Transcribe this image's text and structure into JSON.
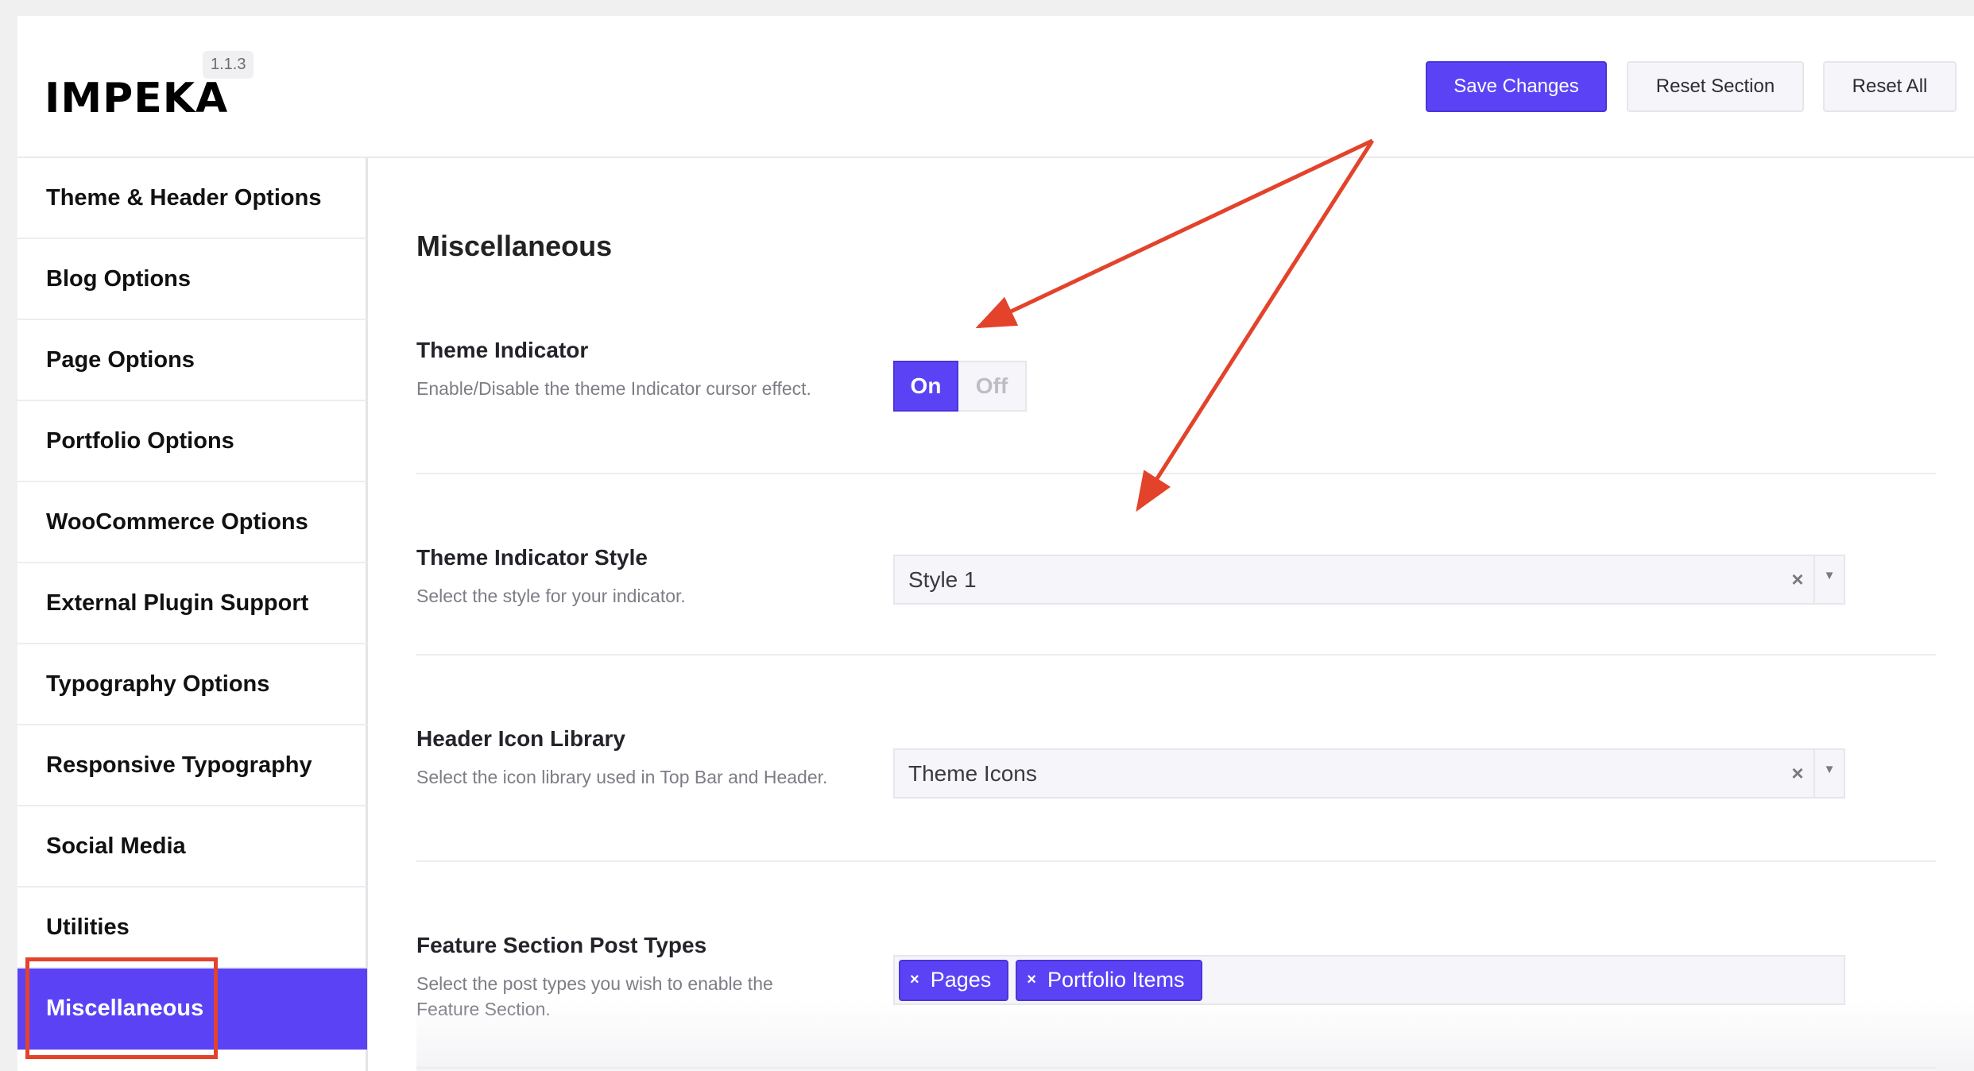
{
  "header": {
    "logo_text": "IMPEKA",
    "version": "1.1.3",
    "buttons": {
      "save": "Save Changes",
      "reset_section": "Reset Section",
      "reset_all": "Reset All"
    }
  },
  "sidebar": {
    "items": [
      {
        "label": "Theme & Header Options"
      },
      {
        "label": "Blog Options"
      },
      {
        "label": "Page Options"
      },
      {
        "label": "Portfolio Options"
      },
      {
        "label": "WooCommerce Options"
      },
      {
        "label": "External Plugin Support"
      },
      {
        "label": "Typography Options"
      },
      {
        "label": "Responsive Typography"
      },
      {
        "label": "Social Media"
      },
      {
        "label": "Utilities"
      },
      {
        "label": "Miscellaneous",
        "active": true
      }
    ]
  },
  "main": {
    "title": "Miscellaneous",
    "fields": {
      "theme_indicator": {
        "label": "Theme Indicator",
        "description": "Enable/Disable the theme Indicator cursor effect.",
        "on_label": "On",
        "off_label": "Off",
        "value": "On"
      },
      "theme_indicator_style": {
        "label": "Theme Indicator Style",
        "description": "Select the style for your indicator.",
        "value": "Style 1"
      },
      "header_icon_library": {
        "label": "Header Icon Library",
        "description": "Select the icon library used in Top Bar and Header.",
        "value": "Theme Icons"
      },
      "feature_section_post_types": {
        "label": "Feature Section Post Types",
        "description": "Select the post types you wish to enable the Feature Section.",
        "tags": [
          "Pages",
          "Portfolio Items"
        ]
      }
    }
  },
  "icons": {
    "clear": "×",
    "dropdown": "▼",
    "tag_remove": "×"
  },
  "colors": {
    "accent": "#5b43f5",
    "annotation": "#e3432b"
  }
}
